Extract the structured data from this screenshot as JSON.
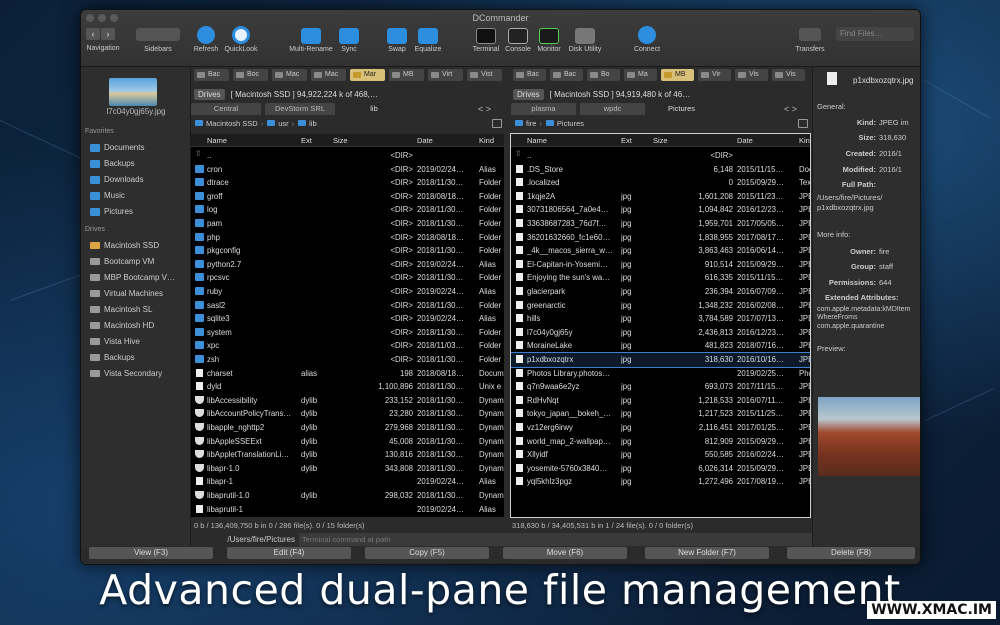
{
  "window": {
    "title": "DCommander"
  },
  "toolbar": {
    "items": [
      {
        "label": "Navigation"
      },
      {
        "label": "Sidebars"
      },
      {
        "label": "Refresh"
      },
      {
        "label": "QuickLook"
      },
      {
        "label": "Multi-Rename"
      },
      {
        "label": "Sync"
      },
      {
        "label": "Swap"
      },
      {
        "label": "Equalize"
      },
      {
        "label": "Terminal"
      },
      {
        "label": "Console"
      },
      {
        "label": "Monitor"
      },
      {
        "label": "Disk Utility"
      },
      {
        "label": "Connect"
      },
      {
        "label": "Transfers"
      }
    ],
    "search_placeholder": "Find Files…",
    "back": "‹",
    "forward": "›"
  },
  "sidebar": {
    "preview_name": "l7c04y0gj65y.jpg",
    "favorites_title": "Favorites",
    "favorites": [
      {
        "label": "Documents"
      },
      {
        "label": "Backups"
      },
      {
        "label": "Downloads"
      },
      {
        "label": "Music"
      },
      {
        "label": "Pictures"
      }
    ],
    "drives_title": "Drives",
    "drives": [
      {
        "label": "Macintosh SSD"
      },
      {
        "label": "Bootcamp VM"
      },
      {
        "label": "MBP Bootcamp V…"
      },
      {
        "label": "Virtual Machines"
      },
      {
        "label": "Macintosh SL"
      },
      {
        "label": "Macintosh HD"
      },
      {
        "label": "Vista Hive"
      },
      {
        "label": "Backups"
      },
      {
        "label": "Vista Secondary"
      }
    ]
  },
  "left": {
    "drive_tabs": [
      "Bac",
      "Boc",
      "Mac",
      "Mac",
      "Mar",
      "MB",
      "Virt",
      "Vist"
    ],
    "drives_btn": "Drives",
    "drive_info": "[ Macintosh SSD ]  94,922,224 k of 468,…",
    "tabs": [
      "Central",
      "DevStorm SRL",
      "lib"
    ],
    "crumbs": [
      "Macintosh SSD",
      "usr",
      "lib"
    ],
    "columns": [
      "Name",
      "Ext",
      "Size",
      "Date",
      "Kind"
    ],
    "rows": [
      {
        "n": "..",
        "e": "",
        "s": "<DIR>",
        "d": "",
        "k": "",
        "t": "up"
      },
      {
        "n": "cron",
        "e": "",
        "s": "<DIR>",
        "d": "2019/02/24…",
        "k": "Alias",
        "t": "dir"
      },
      {
        "n": "dtrace",
        "e": "",
        "s": "<DIR>",
        "d": "2018/11/30…",
        "k": "Folder",
        "t": "dir"
      },
      {
        "n": "groff",
        "e": "",
        "s": "<DIR>",
        "d": "2018/08/18…",
        "k": "Folder",
        "t": "dir"
      },
      {
        "n": "log",
        "e": "",
        "s": "<DIR>",
        "d": "2018/11/30…",
        "k": "Folder",
        "t": "dir"
      },
      {
        "n": "pam",
        "e": "",
        "s": "<DIR>",
        "d": "2018/11/30…",
        "k": "Folder",
        "t": "dir"
      },
      {
        "n": "php",
        "e": "",
        "s": "<DIR>",
        "d": "2018/08/18…",
        "k": "Folder",
        "t": "dir"
      },
      {
        "n": "pkgconfig",
        "e": "",
        "s": "<DIR>",
        "d": "2018/11/30…",
        "k": "Folder",
        "t": "dir"
      },
      {
        "n": "python2.7",
        "e": "",
        "s": "<DIR>",
        "d": "2019/02/24…",
        "k": "Alias",
        "t": "dir"
      },
      {
        "n": "rpcsvc",
        "e": "",
        "s": "<DIR>",
        "d": "2018/11/30…",
        "k": "Folder",
        "t": "dir"
      },
      {
        "n": "ruby",
        "e": "",
        "s": "<DIR>",
        "d": "2019/02/24…",
        "k": "Alias",
        "t": "dir"
      },
      {
        "n": "sasl2",
        "e": "",
        "s": "<DIR>",
        "d": "2018/11/30…",
        "k": "Folder",
        "t": "dir"
      },
      {
        "n": "sqlite3",
        "e": "",
        "s": "<DIR>",
        "d": "2019/02/24…",
        "k": "Alias",
        "t": "dir"
      },
      {
        "n": "system",
        "e": "",
        "s": "<DIR>",
        "d": "2018/11/30…",
        "k": "Folder",
        "t": "dir"
      },
      {
        "n": "xpc",
        "e": "",
        "s": "<DIR>",
        "d": "2018/11/03…",
        "k": "Folder",
        "t": "dir"
      },
      {
        "n": "zsh",
        "e": "",
        "s": "<DIR>",
        "d": "2018/11/30…",
        "k": "Folder",
        "t": "dir"
      },
      {
        "n": "charset",
        "e": "alias",
        "s": "198",
        "d": "2018/08/18…",
        "k": "Docum",
        "t": "file"
      },
      {
        "n": "dyld",
        "e": "",
        "s": "1,100,896",
        "d": "2018/11/30…",
        "k": "Unix e",
        "t": "file"
      },
      {
        "n": "libAccessibility",
        "e": "dylib",
        "s": "233,152",
        "d": "2018/11/30…",
        "k": "Dynam",
        "t": "lib"
      },
      {
        "n": "libAccountPolicyTrans…",
        "e": "dylib",
        "s": "23,280",
        "d": "2018/11/30…",
        "k": "Dynam",
        "t": "lib"
      },
      {
        "n": "libapple_nghttp2",
        "e": "dylib",
        "s": "279,968",
        "d": "2018/11/30…",
        "k": "Dynam",
        "t": "lib"
      },
      {
        "n": "libAppleSSEExt",
        "e": "dylib",
        "s": "45,008",
        "d": "2018/11/30…",
        "k": "Dynam",
        "t": "lib"
      },
      {
        "n": "libAppletTranslationLi…",
        "e": "dylib",
        "s": "130,816",
        "d": "2018/11/30…",
        "k": "Dynam",
        "t": "lib"
      },
      {
        "n": "libapr-1.0",
        "e": "dylib",
        "s": "343,808",
        "d": "2018/11/30…",
        "k": "Dynam",
        "t": "lib"
      },
      {
        "n": "libapr-1",
        "e": "",
        "s": "",
        "d": "2019/02/24…",
        "k": "Alias",
        "t": "file"
      },
      {
        "n": "libaprutil-1.0",
        "e": "dylib",
        "s": "298,032",
        "d": "2018/11/30…",
        "k": "Dynam",
        "t": "lib"
      },
      {
        "n": "libaprutil-1",
        "e": "",
        "s": "",
        "d": "2019/02/24…",
        "k": "Alias",
        "t": "file"
      }
    ],
    "status": "0 b / 136,409,750 b in 0 / 286 file(s).  0 / 15 folder(s)"
  },
  "right": {
    "drive_tabs": [
      "Bac",
      "Bac",
      "Bo",
      "Ma",
      "MB",
      "Vir",
      "Vis",
      "Vis"
    ],
    "drives_btn": "Drives",
    "drive_info": "[ Macintosh SSD ]  94,919,480 k of 46…",
    "tabs": [
      "plasma",
      "wpdc",
      "Pictures"
    ],
    "crumbs": [
      "fire",
      "Pictures"
    ],
    "columns": [
      "Name",
      "Ext",
      "Size",
      "Date",
      "Kind"
    ],
    "rows": [
      {
        "n": "..",
        "e": "",
        "s": "<DIR>",
        "d": "",
        "k": "",
        "t": "up"
      },
      {
        "n": ".DS_Store",
        "e": "",
        "s": "6,148",
        "d": "2015/11/15…",
        "k": "Doc",
        "t": "file"
      },
      {
        "n": ".localized",
        "e": "",
        "s": "0",
        "d": "2015/09/29…",
        "k": "Tex",
        "t": "file"
      },
      {
        "n": "1kqje2A",
        "e": "jpg",
        "s": "1,601,208",
        "d": "2015/11/23…",
        "k": "JPEG",
        "t": "file"
      },
      {
        "n": "30731806564_7a0e4…",
        "e": "jpg",
        "s": "1,094,842",
        "d": "2016/12/23…",
        "k": "JPEG",
        "t": "file"
      },
      {
        "n": "33638687283_76d7f…",
        "e": "jpg",
        "s": "1,959,701",
        "d": "2017/05/05…",
        "k": "JPEG",
        "t": "file"
      },
      {
        "n": "36201632660_fc1e60…",
        "e": "jpg",
        "s": "1,838,955",
        "d": "2017/08/17…",
        "k": "JPEG",
        "t": "file"
      },
      {
        "n": "_4k__macos_sierra_w…",
        "e": "jpg",
        "s": "3,863,463",
        "d": "2016/06/14…",
        "k": "JPEG",
        "t": "file"
      },
      {
        "n": "El-Capitan-in-Yosemi…",
        "e": "jpg",
        "s": "910,514",
        "d": "2015/09/29…",
        "k": "JPEG",
        "t": "file"
      },
      {
        "n": "Enjoying the sun's wa…",
        "e": "jpg",
        "s": "616,335",
        "d": "2015/11/15…",
        "k": "JPEG",
        "t": "file"
      },
      {
        "n": "glacierpark",
        "e": "jpg",
        "s": "236,394",
        "d": "2016/07/09…",
        "k": "JPEG",
        "t": "file"
      },
      {
        "n": "greenarctic",
        "e": "jpg",
        "s": "1,348,232",
        "d": "2016/02/08…",
        "k": "JPEG",
        "t": "file"
      },
      {
        "n": "hills",
        "e": "jpg",
        "s": "3,784,589",
        "d": "2017/07/13…",
        "k": "JPEG",
        "t": "file"
      },
      {
        "n": "l7c04y0gj65y",
        "e": "jpg",
        "s": "2,436,813",
        "d": "2016/12/23…",
        "k": "JPEG",
        "t": "file"
      },
      {
        "n": "MoraineLake",
        "e": "jpg",
        "s": "481,823",
        "d": "2018/07/16…",
        "k": "JPEG",
        "t": "file"
      },
      {
        "n": "p1xdbxozqtrx",
        "e": "jpg",
        "s": "318,630",
        "d": "2016/10/16…",
        "k": "JPEG",
        "t": "file",
        "sel": true
      },
      {
        "n": "Photos Library.photos…",
        "e": "",
        "s": "",
        "d": "2019/02/25…",
        "k": "Pho",
        "t": "file"
      },
      {
        "n": "q7n9waa6e2yz",
        "e": "jpg",
        "s": "693,073",
        "d": "2017/11/15…",
        "k": "JPEG",
        "t": "file"
      },
      {
        "n": "RdHvNqt",
        "e": "jpg",
        "s": "1,218,533",
        "d": "2016/07/11…",
        "k": "JPEG",
        "t": "file"
      },
      {
        "n": "tokyo_japan__bokeh_…",
        "e": "jpg",
        "s": "1,217,523",
        "d": "2015/11/25…",
        "k": "JPEG",
        "t": "file"
      },
      {
        "n": "vz12erg6irwy",
        "e": "jpg",
        "s": "2,116,451",
        "d": "2017/01/25…",
        "k": "JPEG",
        "t": "file"
      },
      {
        "n": "world_map_2-wallpap…",
        "e": "jpg",
        "s": "812,909",
        "d": "2015/09/29…",
        "k": "JPEG",
        "t": "file"
      },
      {
        "n": "Xllyidf",
        "e": "jpg",
        "s": "550,585",
        "d": "2016/02/24…",
        "k": "JPEG",
        "t": "file"
      },
      {
        "n": "yosemite-5760x3840…",
        "e": "jpg",
        "s": "6,026,314",
        "d": "2015/09/29…",
        "k": "JPEG",
        "t": "file"
      },
      {
        "n": "yql5khlz3pgz",
        "e": "jpg",
        "s": "1,272,496",
        "d": "2017/08/19…",
        "k": "JPEG",
        "t": "file"
      }
    ],
    "status": "318,630 b / 34,405,531 b in 1 / 24 file(s).  0 / 0 folder(s)"
  },
  "cmdline": {
    "path": "/Users/fire/Pictures",
    "placeholder": "Terminal command at path"
  },
  "buttons": [
    {
      "label": "View (F3)"
    },
    {
      "label": "Edit (F4)"
    },
    {
      "label": "Copy (F5)"
    },
    {
      "label": "Move (F6)"
    },
    {
      "label": "New Folder (F7)"
    },
    {
      "label": "Delete (F8)"
    }
  ],
  "info": {
    "filename": "p1xdbxozqtrx.jpg",
    "general": "General:",
    "kind_l": "Kind:",
    "kind": "JPEG im",
    "size_l": "Size:",
    "size": "318,630",
    "created_l": "Created:",
    "created": "2016/1",
    "modified_l": "Modified:",
    "modified": "2016/1",
    "fullpath_l": "Full Path:",
    "fullpath": "/Users/fire/Pictures/",
    "fullpath2": "p1xdbxozqtrx.jpg",
    "more": "More info:",
    "owner_l": "Owner:",
    "owner": "fire",
    "group_l": "Group:",
    "group": "staff",
    "perm_l": "Permissions:",
    "perm": "644",
    "ext_l": "Extended Attributes:",
    "ext1": "com.apple.metadata:kMDItem",
    "ext2": "WhereFroms",
    "ext3": "com.apple.quarantine",
    "preview": "Preview:"
  },
  "caption": "Advanced dual-pane file management",
  "watermark": "WWW.XMAC.IM",
  "colors": {
    "accent": "#3a7fd0",
    "folder": "#3a8fd8",
    "selected_tab": "#d9c078"
  }
}
